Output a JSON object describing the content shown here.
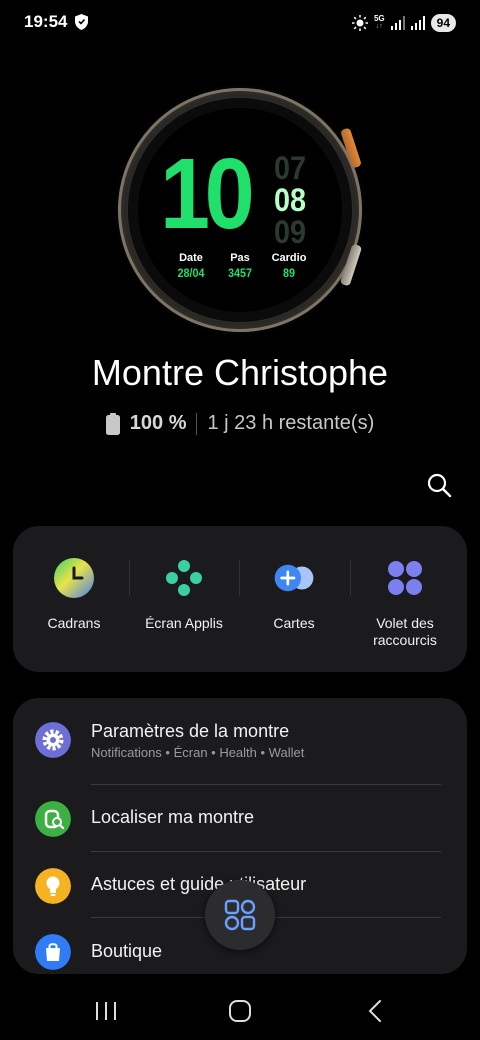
{
  "status_bar": {
    "time": "19:54",
    "network": "5G",
    "battery": "94"
  },
  "watch_face": {
    "hour": "10",
    "minute_prev": "07",
    "minute": "08",
    "minute_next": "09",
    "complications": [
      {
        "label": "Date",
        "value": "28/04"
      },
      {
        "label": "Pas",
        "value": "3457"
      },
      {
        "label": "Cardio",
        "value": "89"
      }
    ],
    "accent_color": "#1fe06a"
  },
  "device": {
    "name": "Montre Christophe",
    "battery_percent": "100 %",
    "remaining": "1 j 23 h restante(s)"
  },
  "quick_tiles": [
    {
      "label": "Cadrans",
      "icon": "watch-faces-icon"
    },
    {
      "label": "Écran Applis",
      "icon": "apps-screen-icon"
    },
    {
      "label": "Cartes",
      "icon": "tiles-icon"
    },
    {
      "label": "Volet des raccourcis",
      "icon": "quick-panel-icon"
    }
  ],
  "menu": [
    {
      "title": "Paramètres de la montre",
      "subtitle": "Notifications • Écran • Health • Wallet",
      "icon": "settings-gear-icon",
      "color": "#6b6fd6"
    },
    {
      "title": "Localiser ma montre",
      "subtitle": "",
      "icon": "find-watch-icon",
      "color": "#3cb043"
    },
    {
      "title": "Astuces et guide utilisateur",
      "subtitle": "",
      "icon": "lightbulb-icon",
      "color": "#f5b324"
    },
    {
      "title": "Boutique",
      "subtitle": "",
      "icon": "shopping-bag-icon",
      "color": "#2f7cf6"
    }
  ],
  "nav": {
    "recents": "recents-icon",
    "home": "home-icon",
    "back": "back-icon"
  }
}
